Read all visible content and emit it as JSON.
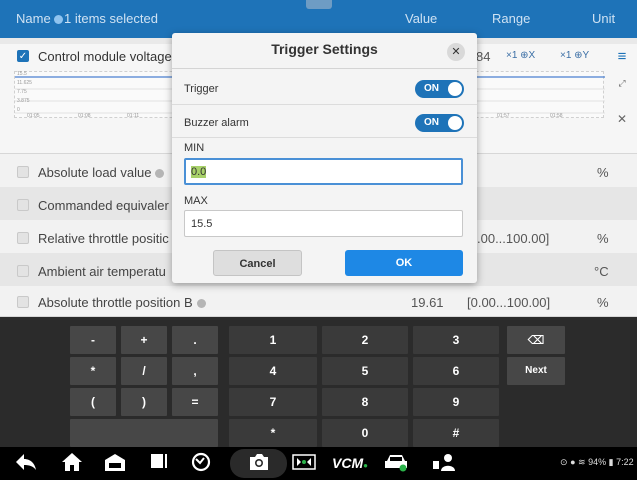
{
  "header": {
    "name_col": "Name",
    "selected_text": "1 items selected",
    "value_col": "Value",
    "range_col": "Range",
    "unit_col": "Unit"
  },
  "graph_row": {
    "label": "Control module voltage",
    "value_partial": "84",
    "zoom_x": "×1 ⊕X",
    "zoom_y": "×1 ⊕Y",
    "y_ticks": [
      "15.5",
      "11.625",
      "7.75",
      "3.875",
      "0"
    ],
    "x_ticks": [
      "01:05",
      "01:08",
      "01:11",
      "01:57",
      "01:58"
    ]
  },
  "rows": [
    {
      "name": "Absolute load value",
      "value": "",
      "range": "",
      "unit": "%"
    },
    {
      "name": "Commanded equivaler",
      "value": "",
      "range": "",
      "unit": ""
    },
    {
      "name": "Relative throttle positic",
      "value": "",
      "range": ".00...100.00]",
      "unit": "%"
    },
    {
      "name": "Ambient air temperatu",
      "value": "",
      "range": "",
      "unit": "°C"
    },
    {
      "name": "Absolute throttle position B",
      "value": "19.61",
      "range": "[0.00...100.00]",
      "unit": "%"
    }
  ],
  "dialog": {
    "title": "Trigger Settings",
    "close_icon": "✕",
    "trigger_label": "Trigger",
    "trigger_state": "ON",
    "buzzer_label": "Buzzer alarm",
    "buzzer_state": "ON",
    "min_label": "MIN",
    "min_value": "0.0",
    "max_label": "MAX",
    "max_value": "15.5",
    "cancel_label": "Cancel",
    "ok_label": "OK"
  },
  "keypad": {
    "keys": [
      "-",
      "+",
      ".",
      "1",
      "2",
      "3",
      "⌫",
      "*",
      "/",
      ",",
      "4",
      "5",
      "6",
      "Next",
      "(",
      ")",
      "=",
      "7",
      "8",
      "9",
      "*",
      "0",
      "#"
    ]
  },
  "status": {
    "battery": "94%",
    "time": "7:22"
  },
  "colors": {
    "accent": "#1e73b8",
    "ok_button": "#1e88e5",
    "keypad_bg": "#2b2b2b"
  }
}
